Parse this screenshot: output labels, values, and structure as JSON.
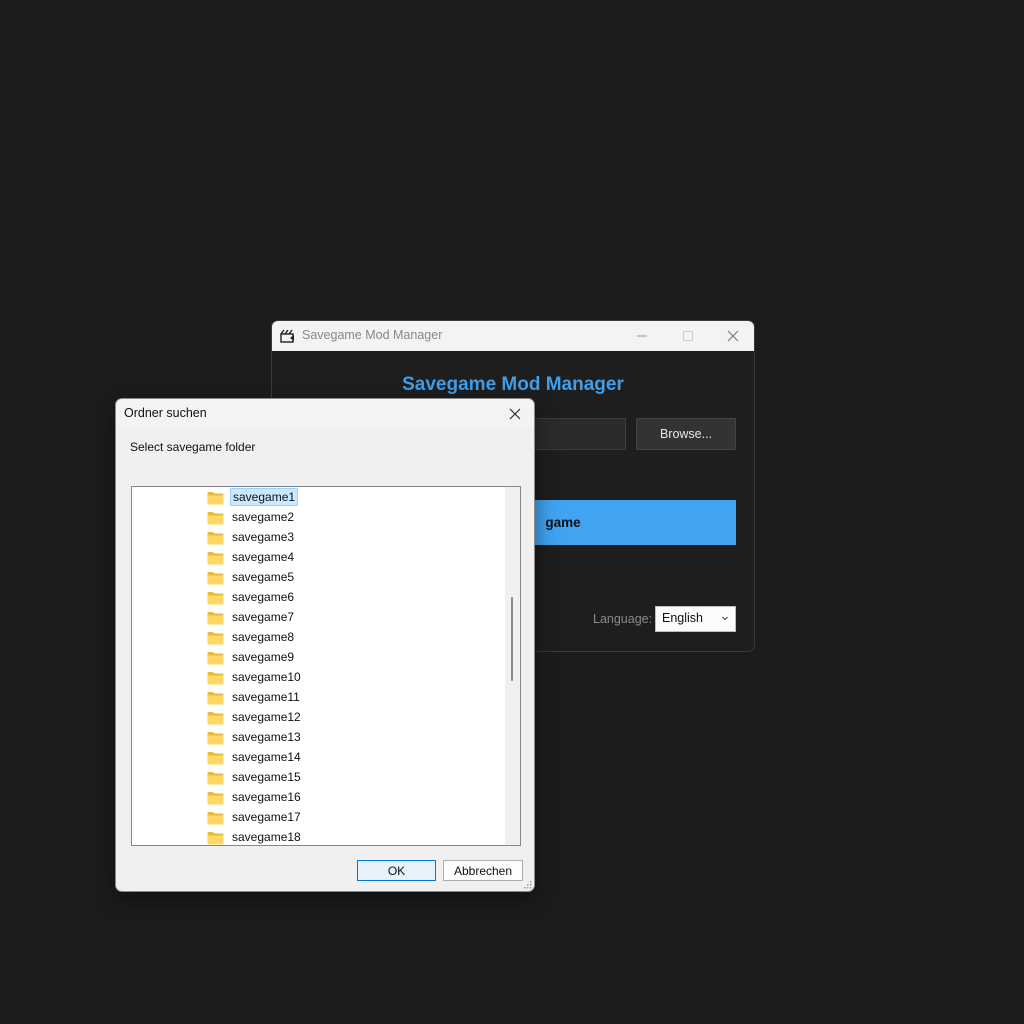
{
  "app_window": {
    "title": "Savegame Mod Manager",
    "heading": "Savegame Mod Manager",
    "path_value": "",
    "browse_label": "Browse...",
    "action_label_visible": "game",
    "language_label": "Language:",
    "language_selected": "English",
    "accent_color": "#3f9fea"
  },
  "dialog": {
    "title": "Ordner suchen",
    "instruction": "Select savegame folder",
    "folders": [
      "savegame1",
      "savegame2",
      "savegame3",
      "savegame4",
      "savegame5",
      "savegame6",
      "savegame7",
      "savegame8",
      "savegame9",
      "savegame10",
      "savegame11",
      "savegame12",
      "savegame13",
      "savegame14",
      "savegame15",
      "savegame16",
      "savegame17",
      "savegame18"
    ],
    "selected_folder": "savegame1",
    "ok_label": "OK",
    "cancel_label": "Abbrechen"
  },
  "icons": {
    "folder": "folder-icon",
    "close": "close-icon",
    "minimize": "minimize-icon",
    "maximize": "maximize-icon",
    "chevron": "chevron-down-icon"
  }
}
